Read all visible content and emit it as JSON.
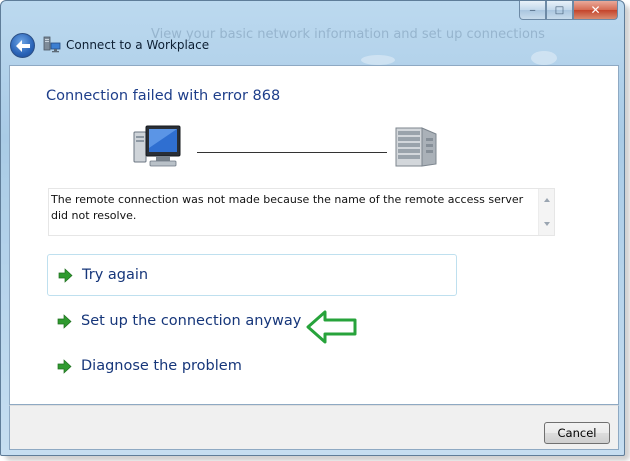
{
  "window": {
    "title": "Connect to a Workplace",
    "background_text": "View your basic network information and set up connections",
    "caption_buttons": {
      "minimize": "‒",
      "maximize": "□",
      "close": "✕"
    }
  },
  "dialog": {
    "heading": "Connection failed with error 868",
    "message": "The remote connection was not made because the name of the remote access server did not resolve.",
    "icons": {
      "client": "computer-icon",
      "server": "server-icon"
    }
  },
  "options": [
    {
      "label": "Try again",
      "icon": "green-arrow-icon"
    },
    {
      "label": "Set up the connection anyway",
      "icon": "green-arrow-icon"
    },
    {
      "label": "Diagnose the problem",
      "icon": "green-arrow-icon"
    }
  ],
  "footer": {
    "cancel_label": "Cancel"
  },
  "colors": {
    "heading": "#1e3e8a",
    "link": "#16367a",
    "arrow_green": "#2f9a2f",
    "annotation_arrow": "#27a33b"
  }
}
